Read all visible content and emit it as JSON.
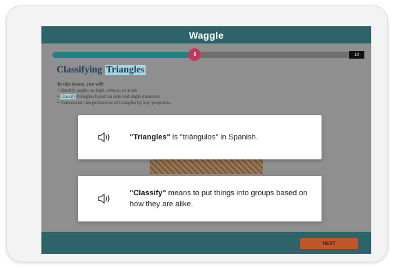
{
  "app": {
    "title": "Waggle"
  },
  "progress": {
    "current": "5",
    "total": "10",
    "fraction": 0.465
  },
  "lesson": {
    "title_part1": "Classifying",
    "title_part2": "Triangles",
    "intro": "In this lesson, you will:",
    "objectives": [
      {
        "bullet": "•",
        "text": "Identify angles as right, obtuse, or acute"
      },
      {
        "bullet": "•",
        "highlight": "Classify",
        "text": "triangles based on side and angle measures"
      },
      {
        "bullet": "•",
        "text": "Understand categorizations of triangles by key properties"
      }
    ]
  },
  "popups": [
    {
      "term": "\"Triangles\"",
      "definition": " is \"triángulos\" in Spanish.",
      "icon": "speaker-icon"
    },
    {
      "term": "\"Classify\"",
      "definition": " means to put things into groups based on how they are alike.",
      "icon": "speaker-icon"
    }
  ],
  "footer": {
    "next_label": "NEXT"
  },
  "colors": {
    "teal": "#2c6469",
    "progress": "#1f8287",
    "knob": "#c4365f",
    "next": "#c0562a"
  }
}
